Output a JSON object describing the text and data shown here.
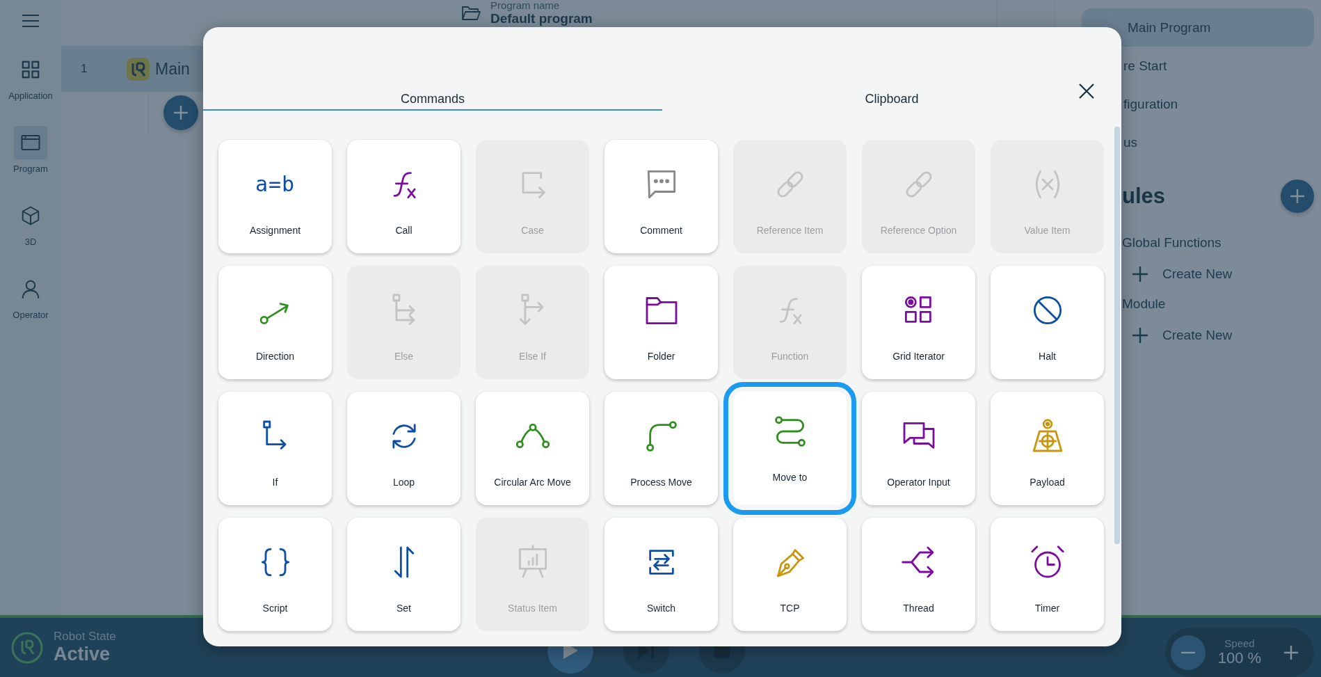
{
  "rail": {
    "items": [
      {
        "label": "Application",
        "kind": "apps",
        "selected": false
      },
      {
        "label": "Program",
        "kind": "window",
        "selected": true
      },
      {
        "label": "3D",
        "kind": "cube",
        "selected": false
      },
      {
        "label": "Operator",
        "kind": "person",
        "selected": false
      }
    ]
  },
  "program": {
    "name_label": "Program name",
    "name": "Default program",
    "rows": [
      {
        "number": "1",
        "label": "Main",
        "selected": true
      }
    ]
  },
  "side_panel": {
    "items": [
      {
        "label": "Main Program",
        "selected": true
      },
      {
        "label": "re Start",
        "selected": false
      },
      {
        "label": "figuration",
        "selected": false
      },
      {
        "label": "us",
        "selected": false
      }
    ],
    "heading": "ules",
    "groups": [
      {
        "label": "Global Functions",
        "action": "Create New"
      },
      {
        "label": "Module",
        "action": "Create New"
      }
    ]
  },
  "status_bar": {
    "state_label": "Robot State",
    "state": "Active",
    "speed_label": "Speed",
    "speed": "100 %"
  },
  "dialog": {
    "tabs": [
      {
        "label": "Commands",
        "selected": true
      },
      {
        "label": "Clipboard",
        "selected": false
      }
    ],
    "commands": [
      {
        "label": "Assignment",
        "kind": "assignment",
        "glyph": "a=b",
        "color": "#0d4fa6",
        "disabled": false,
        "selected": false
      },
      {
        "label": "Call",
        "kind": "call",
        "color": "#7b0d9e",
        "disabled": false,
        "selected": false
      },
      {
        "label": "Case",
        "kind": "case",
        "disabled": true,
        "selected": false
      },
      {
        "label": "Comment",
        "kind": "comment",
        "color": "#878787",
        "disabled": false,
        "selected": false
      },
      {
        "label": "Reference Item",
        "kind": "link",
        "disabled": true,
        "selected": false
      },
      {
        "label": "Reference Option",
        "kind": "link",
        "disabled": true,
        "selected": false
      },
      {
        "label": "Value Item",
        "kind": "value",
        "disabled": true,
        "selected": false
      },
      {
        "label": "Direction",
        "kind": "direction",
        "color": "#2f8f1f",
        "disabled": false,
        "selected": false
      },
      {
        "label": "Else",
        "kind": "else",
        "disabled": true,
        "selected": false
      },
      {
        "label": "Else If",
        "kind": "elseif",
        "disabled": true,
        "selected": false
      },
      {
        "label": "Folder",
        "kind": "folder",
        "color": "#7b0d9e",
        "disabled": false,
        "selected": false
      },
      {
        "label": "Function",
        "kind": "call",
        "disabled": true,
        "selected": false
      },
      {
        "label": "Grid Iterator",
        "kind": "grid",
        "color": "#7b0d9e",
        "disabled": false,
        "selected": false
      },
      {
        "label": "Halt",
        "kind": "halt",
        "color": "#0d4fa6",
        "disabled": false,
        "selected": false
      },
      {
        "label": "If",
        "kind": "if",
        "color": "#0d4fa6",
        "disabled": false,
        "selected": false
      },
      {
        "label": "Loop",
        "kind": "loop",
        "color": "#0d4fa6",
        "disabled": false,
        "selected": false
      },
      {
        "label": "Circular Arc Move",
        "kind": "arc",
        "color": "#2f8f1f",
        "disabled": false,
        "selected": false
      },
      {
        "label": "Process Move",
        "kind": "process",
        "color": "#2f8f1f",
        "disabled": false,
        "selected": false
      },
      {
        "label": "Move to",
        "kind": "moveto",
        "color": "#2f8f1f",
        "disabled": false,
        "selected": true
      },
      {
        "label": "Operator Input",
        "kind": "operator",
        "color": "#7b0d9e",
        "disabled": false,
        "selected": false
      },
      {
        "label": "Payload",
        "kind": "payload",
        "color": "#c8960f",
        "disabled": false,
        "selected": false
      },
      {
        "label": "Script",
        "kind": "script",
        "color": "#0d4fa6",
        "disabled": false,
        "selected": false
      },
      {
        "label": "Set",
        "kind": "set",
        "color": "#0d4fa6",
        "disabled": false,
        "selected": false
      },
      {
        "label": "Status Item",
        "kind": "status",
        "disabled": true,
        "selected": false
      },
      {
        "label": "Switch",
        "kind": "switch",
        "color": "#0d4fa6",
        "disabled": false,
        "selected": false
      },
      {
        "label": "TCP",
        "kind": "tcp",
        "color": "#c8960f",
        "disabled": false,
        "selected": false
      },
      {
        "label": "Thread",
        "kind": "thread",
        "color": "#7b0d9e",
        "disabled": false,
        "selected": false
      },
      {
        "label": "Timer",
        "kind": "timer",
        "color": "#7b0d9e",
        "disabled": false,
        "selected": false
      }
    ]
  }
}
